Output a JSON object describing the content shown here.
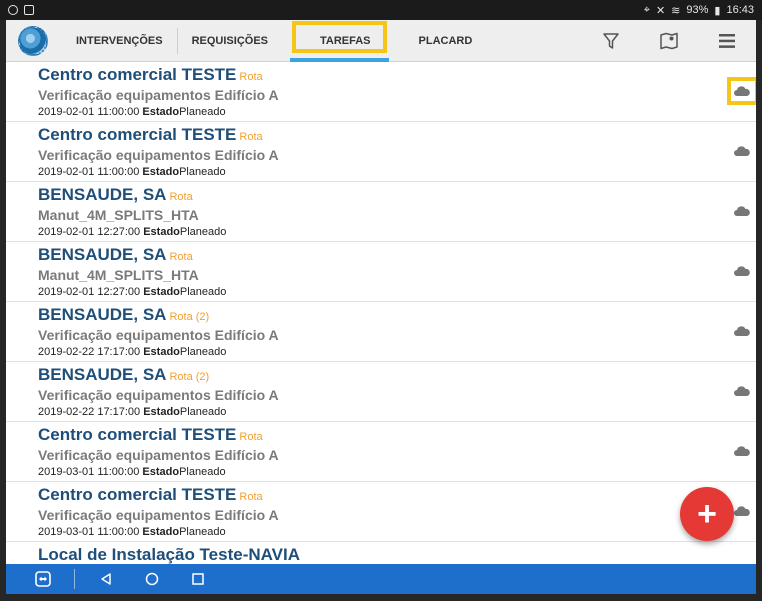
{
  "status_bar": {
    "battery": "93%",
    "time": "16:43"
  },
  "nav": {
    "logo_icon": "globe-logo-icon",
    "tabs": [
      {
        "label": "INTERVENÇÕES"
      },
      {
        "label": "REQUISIÇÕES"
      },
      {
        "label": "TAREFAS",
        "active": true
      },
      {
        "label": "PLACARD"
      }
    ],
    "actions": [
      "filter-icon",
      "map-icon",
      "menu-icon"
    ]
  },
  "colors": {
    "title": "#1f4e79",
    "route": "#f0a030",
    "highlight": "#f5c518",
    "active_tab_underline": "#3aa3e3",
    "fab": "#e53935",
    "bottom_bar": "#1e6fcc"
  },
  "tasks": [
    {
      "title": "Centro comercial TESTE",
      "route": "Rota",
      "description": "Verificação equipamentos Edifício A",
      "datetime": "2019-02-01 11:00:00",
      "state_label": "Estado",
      "state": "Planeado",
      "sync_icon": "cloud-icon"
    },
    {
      "title": "Centro comercial TESTE",
      "route": "Rota",
      "description": "Verificação equipamentos Edifício A",
      "datetime": "2019-02-01 11:00:00",
      "state_label": "Estado",
      "state": "Planeado",
      "sync_icon": "cloud-icon"
    },
    {
      "title": "BENSAUDE, SA",
      "route": "Rota",
      "description": "Manut_4M_SPLITS_HTA",
      "datetime": "2019-02-01 12:27:00",
      "state_label": "Estado",
      "state": "Planeado",
      "sync_icon": "cloud-icon"
    },
    {
      "title": "BENSAUDE, SA",
      "route": "Rota",
      "description": "Manut_4M_SPLITS_HTA",
      "datetime": "2019-02-01 12:27:00",
      "state_label": "Estado",
      "state": "Planeado",
      "sync_icon": "cloud-icon"
    },
    {
      "title": "BENSAUDE, SA",
      "route": "Rota (2)",
      "description": "Verificação equipamentos Edifício A",
      "datetime": "2019-02-22 17:17:00",
      "state_label": "Estado",
      "state": "Planeado",
      "sync_icon": "cloud-icon"
    },
    {
      "title": "BENSAUDE, SA",
      "route": "Rota (2)",
      "description": "Verificação equipamentos Edifício A",
      "datetime": "2019-02-22 17:17:00",
      "state_label": "Estado",
      "state": "Planeado",
      "sync_icon": "cloud-icon"
    },
    {
      "title": "Centro comercial TESTE",
      "route": "Rota",
      "description": "Verificação equipamentos Edifício A",
      "datetime": "2019-03-01 11:00:00",
      "state_label": "Estado",
      "state": "Planeado",
      "sync_icon": "cloud-icon"
    },
    {
      "title": "Centro comercial TESTE",
      "route": "Rota",
      "description": "Verificação equipamentos Edifício A",
      "datetime": "2019-03-01 11:00:00",
      "state_label": "Estado",
      "state": "Planeado",
      "sync_icon": "cloud-icon"
    },
    {
      "title": "Local de Instalação Teste-NAVIA"
    }
  ],
  "fab": {
    "label": "+"
  },
  "bottom_bar": {
    "icons": [
      "teamviewer-icon",
      "back-icon",
      "home-icon",
      "recents-icon"
    ]
  }
}
